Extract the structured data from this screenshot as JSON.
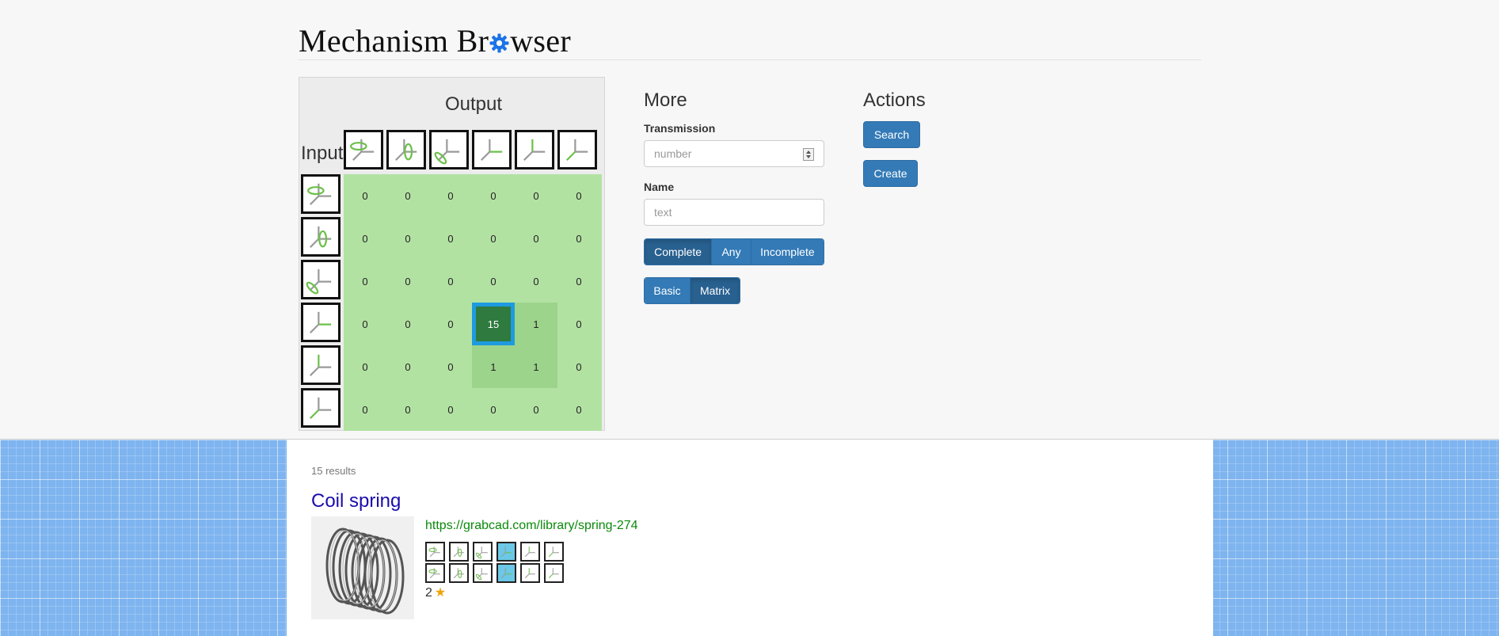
{
  "header": {
    "title_before": "Mechanism Br",
    "title_after": "wser"
  },
  "matrix": {
    "output_label": "Output",
    "input_label": "Input",
    "axis_icons": [
      "rotate-x",
      "rotate-y",
      "rotate-z",
      "translate-x",
      "translate-y",
      "translate-z"
    ],
    "rows": [
      [
        "0",
        "0",
        "0",
        "0",
        "0",
        "0"
      ],
      [
        "0",
        "0",
        "0",
        "0",
        "0",
        "0"
      ],
      [
        "0",
        "0",
        "0",
        "0",
        "0",
        "0"
      ],
      [
        "0",
        "0",
        "0",
        "15",
        "1",
        "0"
      ],
      [
        "0",
        "0",
        "0",
        "1",
        "1",
        "0"
      ],
      [
        "0",
        "0",
        "0",
        "0",
        "0",
        "0"
      ]
    ],
    "selected": "15"
  },
  "more": {
    "heading": "More",
    "transmission_label": "Transmission",
    "transmission_placeholder": "number",
    "name_label": "Name",
    "name_placeholder": "text",
    "completeness": {
      "options": [
        "Complete",
        "Any",
        "Incomplete"
      ],
      "selected": "Complete"
    },
    "view": {
      "options": [
        "Basic",
        "Matrix"
      ],
      "selected": "Matrix"
    }
  },
  "actions": {
    "heading": "Actions",
    "search": "Search",
    "create": "Create"
  },
  "results": {
    "count": "15 results",
    "items": [
      {
        "title": "Coil spring",
        "url": "https://grabcad.com/library/spring-274",
        "rating": "2",
        "star": "★"
      }
    ]
  },
  "colors": {
    "accent": "#337ab7",
    "cell_green": "#b2e2a2",
    "selected_cell": "#2f7a3e",
    "selected_border": "#1e9be0",
    "highlight": "#6bc8e6"
  }
}
